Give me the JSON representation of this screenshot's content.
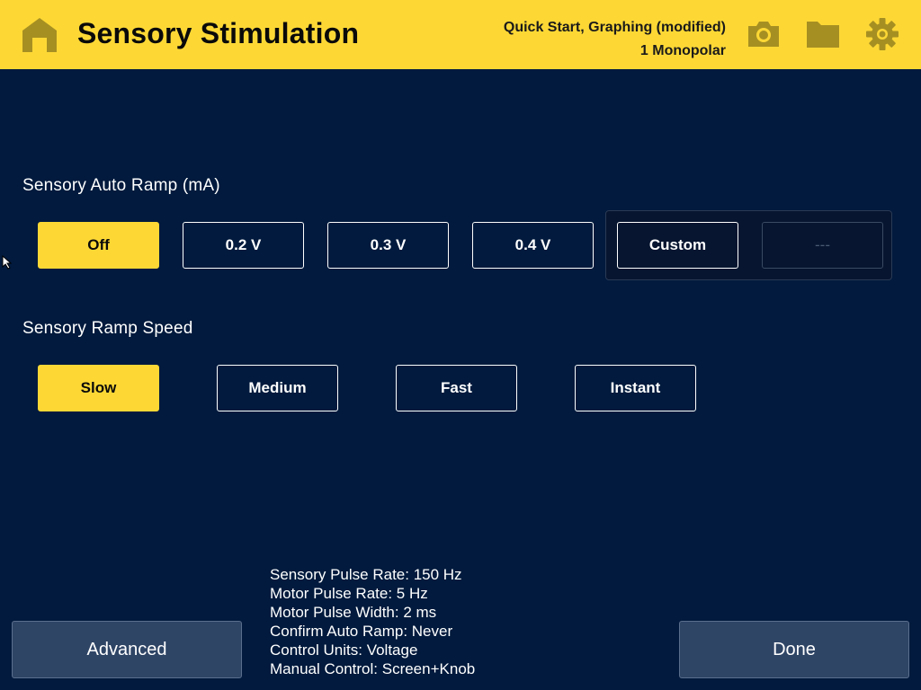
{
  "header": {
    "title": "Sensory Stimulation",
    "info_line1": "Quick Start, Graphing (modified)",
    "info_line2": "1 Monopolar",
    "icons": [
      "home-icon",
      "camera-icon",
      "folder-icon",
      "gear-icon"
    ]
  },
  "colors": {
    "accent": "#fdd835",
    "background": "#011a3d",
    "icon": "#a68f22",
    "button_secondary": "#2f4566"
  },
  "auto_ramp": {
    "label": "Sensory Auto Ramp (mA)",
    "options": [
      "Off",
      "0.2 V",
      "0.3 V",
      "0.4 V",
      "Custom",
      "---"
    ],
    "selected": "Off"
  },
  "ramp_speed": {
    "label": "Sensory Ramp Speed",
    "options": [
      "Slow",
      "Medium",
      "Fast",
      "Instant"
    ],
    "selected": "Slow"
  },
  "summary": [
    "Sensory Pulse Rate: 150 Hz",
    "Motor Pulse Rate: 5 Hz",
    "Motor Pulse Width: 2 ms",
    "Confirm Auto Ramp: Never",
    "Control Units: Voltage",
    "Manual Control: Screen+Knob"
  ],
  "footer": {
    "advanced_label": "Advanced",
    "done_label": "Done"
  }
}
